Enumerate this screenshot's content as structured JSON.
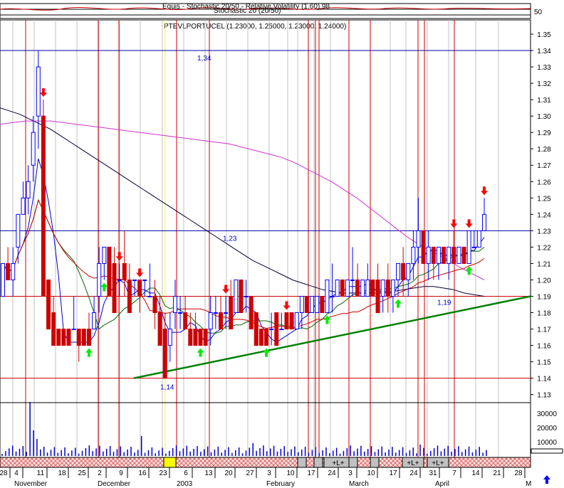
{
  "chart_data": {
    "type": "candlestick",
    "title": "PTEVLPORTUCEL (1.23000, 1.25000, 1.23000, 1.24000)",
    "top_panel": {
      "title_overlap": "Equis - Stochastic 20/50 - Relative Volatility (1.60) 98",
      "title_line2": "Stochastic 20 (20/50)",
      "tick_label": "50"
    },
    "y_ticks": [
      "1.35",
      "1.34",
      "1.33",
      "1.32",
      "1.31",
      "1.30",
      "1.29",
      "1.28",
      "1.27",
      "1.26",
      "1.25",
      "1.24",
      "1.23",
      "1.22",
      "1.21",
      "1.20",
      "1.19",
      "1.18",
      "1.17",
      "1.16",
      "1.15",
      "1.14",
      "1.13"
    ],
    "ylim": [
      1.125,
      1.355
    ],
    "volume_ticks": [
      "30000",
      "20000",
      "10000"
    ],
    "x_day_labels": [
      "28",
      "4",
      "11",
      "18",
      "25",
      "2",
      "9",
      "16",
      "23",
      "6",
      "13",
      "20",
      "27",
      "3",
      "10",
      "17",
      "24",
      "3",
      "10",
      "17",
      "24",
      "31",
      "7",
      "14",
      "21",
      "28"
    ],
    "x_month_labels": [
      "November",
      "December",
      "2003",
      "February",
      "March",
      "April",
      "M"
    ],
    "levels": [
      {
        "value": 1.34,
        "label": "1,34"
      },
      {
        "value": 1.23,
        "label": "1,23"
      },
      {
        "value": 1.19,
        "label": "1,19"
      },
      {
        "value": 1.14,
        "label": "1,14"
      }
    ],
    "level_lines": [
      1.34,
      1.23,
      1.19,
      1.14
    ],
    "trendline": {
      "from": 1.14,
      "to": 1.19,
      "color": "#008000"
    },
    "period_tags": [
      "+L+",
      "+L+",
      "+L+"
    ],
    "candles": [
      {
        "o": 1.19,
        "h": 1.21,
        "l": 1.19,
        "c": 1.21
      },
      {
        "o": 1.21,
        "h": 1.22,
        "l": 1.2,
        "c": 1.2
      },
      {
        "o": 1.2,
        "h": 1.22,
        "l": 1.19,
        "c": 1.21
      },
      {
        "o": 1.22,
        "h": 1.24,
        "l": 1.21,
        "c": 1.24
      },
      {
        "o": 1.24,
        "h": 1.26,
        "l": 1.24,
        "c": 1.25
      },
      {
        "o": 1.25,
        "h": 1.27,
        "l": 1.24,
        "c": 1.26
      },
      {
        "o": 1.27,
        "h": 1.3,
        "l": 1.26,
        "c": 1.29
      },
      {
        "o": 1.3,
        "h": 1.34,
        "l": 1.28,
        "c": 1.33
      },
      {
        "o": 1.3,
        "h": 1.31,
        "l": 1.19,
        "c": 1.19
      },
      {
        "o": 1.2,
        "h": 1.2,
        "l": 1.17,
        "c": 1.17
      },
      {
        "o": 1.18,
        "h": 1.19,
        "l": 1.16,
        "c": 1.16
      },
      {
        "o": 1.17,
        "h": 1.17,
        "l": 1.16,
        "c": 1.16
      },
      {
        "o": 1.17,
        "h": 1.17,
        "l": 1.16,
        "c": 1.16
      },
      {
        "o": 1.17,
        "h": 1.17,
        "l": 1.16,
        "c": 1.16
      },
      {
        "o": 1.17,
        "h": 1.19,
        "l": 1.17,
        "c": 1.17
      },
      {
        "o": 1.17,
        "h": 1.17,
        "l": 1.15,
        "c": 1.16
      },
      {
        "o": 1.17,
        "h": 1.17,
        "l": 1.16,
        "c": 1.16
      },
      {
        "o": 1.17,
        "h": 1.18,
        "l": 1.16,
        "c": 1.16
      },
      {
        "o": 1.17,
        "h": 1.19,
        "l": 1.17,
        "c": 1.18
      },
      {
        "o": 1.19,
        "h": 1.22,
        "l": 1.18,
        "c": 1.21
      },
      {
        "o": 1.21,
        "h": 1.22,
        "l": 1.2,
        "c": 1.22
      },
      {
        "o": 1.22,
        "h": 1.22,
        "l": 1.19,
        "c": 1.19
      },
      {
        "o": 1.21,
        "h": 1.22,
        "l": 1.18,
        "c": 1.18
      },
      {
        "o": 1.2,
        "h": 1.21,
        "l": 1.19,
        "c": 1.2
      },
      {
        "o": 1.21,
        "h": 1.23,
        "l": 1.19,
        "c": 1.2
      },
      {
        "o": 1.2,
        "h": 1.21,
        "l": 1.18,
        "c": 1.18
      },
      {
        "o": 1.2,
        "h": 1.2,
        "l": 1.19,
        "c": 1.2
      },
      {
        "o": 1.2,
        "h": 1.2,
        "l": 1.18,
        "c": 1.19
      },
      {
        "o": 1.2,
        "h": 1.2,
        "l": 1.19,
        "c": 1.2
      },
      {
        "o": 1.19,
        "h": 1.21,
        "l": 1.19,
        "c": 1.19
      },
      {
        "o": 1.19,
        "h": 1.2,
        "l": 1.17,
        "c": 1.18
      },
      {
        "o": 1.18,
        "h": 1.19,
        "l": 1.16,
        "c": 1.16
      },
      {
        "o": 1.17,
        "h": 1.18,
        "l": 1.14,
        "c": 1.14
      },
      {
        "o": 1.16,
        "h": 1.18,
        "l": 1.15,
        "c": 1.17
      },
      {
        "o": 1.18,
        "h": 1.2,
        "l": 1.17,
        "c": 1.19
      },
      {
        "o": 1.18,
        "h": 1.19,
        "l": 1.17,
        "c": 1.18
      },
      {
        "o": 1.18,
        "h": 1.19,
        "l": 1.17,
        "c": 1.17
      },
      {
        "o": 1.17,
        "h": 1.18,
        "l": 1.16,
        "c": 1.16
      },
      {
        "o": 1.17,
        "h": 1.18,
        "l": 1.16,
        "c": 1.16
      },
      {
        "o": 1.17,
        "h": 1.17,
        "l": 1.16,
        "c": 1.16
      },
      {
        "o": 1.17,
        "h": 1.17,
        "l": 1.16,
        "c": 1.16
      },
      {
        "o": 1.17,
        "h": 1.19,
        "l": 1.16,
        "c": 1.18
      },
      {
        "o": 1.18,
        "h": 1.19,
        "l": 1.17,
        "c": 1.18
      },
      {
        "o": 1.18,
        "h": 1.19,
        "l": 1.17,
        "c": 1.17
      },
      {
        "o": 1.18,
        "h": 1.19,
        "l": 1.17,
        "c": 1.18
      },
      {
        "o": 1.19,
        "h": 1.2,
        "l": 1.17,
        "c": 1.17
      },
      {
        "o": 1.18,
        "h": 1.2,
        "l": 1.18,
        "c": 1.2
      },
      {
        "o": 1.2,
        "h": 1.2,
        "l": 1.18,
        "c": 1.18
      },
      {
        "o": 1.19,
        "h": 1.2,
        "l": 1.18,
        "c": 1.19
      },
      {
        "o": 1.19,
        "h": 1.19,
        "l": 1.17,
        "c": 1.17
      },
      {
        "o": 1.18,
        "h": 1.18,
        "l": 1.16,
        "c": 1.16
      },
      {
        "o": 1.17,
        "h": 1.17,
        "l": 1.16,
        "c": 1.16
      },
      {
        "o": 1.17,
        "h": 1.17,
        "l": 1.16,
        "c": 1.16
      },
      {
        "o": 1.17,
        "h": 1.18,
        "l": 1.16,
        "c": 1.17
      },
      {
        "o": 1.18,
        "h": 1.18,
        "l": 1.16,
        "c": 1.16
      },
      {
        "o": 1.17,
        "h": 1.18,
        "l": 1.17,
        "c": 1.17
      },
      {
        "o": 1.18,
        "h": 1.18,
        "l": 1.17,
        "c": 1.17
      },
      {
        "o": 1.18,
        "h": 1.18,
        "l": 1.17,
        "c": 1.17
      },
      {
        "o": 1.17,
        "h": 1.18,
        "l": 1.17,
        "c": 1.18
      },
      {
        "o": 1.18,
        "h": 1.19,
        "l": 1.17,
        "c": 1.19
      },
      {
        "o": 1.19,
        "h": 1.19,
        "l": 1.18,
        "c": 1.18
      },
      {
        "o": 1.18,
        "h": 1.19,
        "l": 1.18,
        "c": 1.19
      },
      {
        "o": 1.18,
        "h": 1.19,
        "l": 1.18,
        "c": 1.19
      },
      {
        "o": 1.19,
        "h": 1.19,
        "l": 1.18,
        "c": 1.18
      },
      {
        "o": 1.18,
        "h": 1.2,
        "l": 1.18,
        "c": 1.2
      },
      {
        "o": 1.19,
        "h": 1.21,
        "l": 1.18,
        "c": 1.19
      },
      {
        "o": 1.19,
        "h": 1.2,
        "l": 1.19,
        "c": 1.2
      },
      {
        "o": 1.2,
        "h": 1.2,
        "l": 1.19,
        "c": 1.19
      },
      {
        "o": 1.19,
        "h": 1.2,
        "l": 1.19,
        "c": 1.2
      },
      {
        "o": 1.2,
        "h": 1.22,
        "l": 1.19,
        "c": 1.2
      },
      {
        "o": 1.2,
        "h": 1.21,
        "l": 1.19,
        "c": 1.19
      },
      {
        "o": 1.19,
        "h": 1.2,
        "l": 1.19,
        "c": 1.2
      },
      {
        "o": 1.19,
        "h": 1.21,
        "l": 1.19,
        "c": 1.2
      },
      {
        "o": 1.2,
        "h": 1.2,
        "l": 1.19,
        "c": 1.19
      },
      {
        "o": 1.2,
        "h": 1.21,
        "l": 1.18,
        "c": 1.18
      },
      {
        "o": 1.19,
        "h": 1.2,
        "l": 1.18,
        "c": 1.2
      },
      {
        "o": 1.2,
        "h": 1.21,
        "l": 1.18,
        "c": 1.19
      },
      {
        "o": 1.19,
        "h": 1.2,
        "l": 1.18,
        "c": 1.2
      },
      {
        "o": 1.2,
        "h": 1.21,
        "l": 1.19,
        "c": 1.21
      },
      {
        "o": 1.21,
        "h": 1.22,
        "l": 1.19,
        "c": 1.2
      },
      {
        "o": 1.2,
        "h": 1.21,
        "l": 1.19,
        "c": 1.21
      },
      {
        "o": 1.21,
        "h": 1.23,
        "l": 1.2,
        "c": 1.22
      },
      {
        "o": 1.22,
        "h": 1.25,
        "l": 1.21,
        "c": 1.23
      },
      {
        "o": 1.23,
        "h": 1.23,
        "l": 1.21,
        "c": 1.21
      },
      {
        "o": 1.21,
        "h": 1.23,
        "l": 1.2,
        "c": 1.22
      },
      {
        "o": 1.22,
        "h": 1.22,
        "l": 1.2,
        "c": 1.21
      },
      {
        "o": 1.21,
        "h": 1.22,
        "l": 1.2,
        "c": 1.22
      },
      {
        "o": 1.22,
        "h": 1.22,
        "l": 1.21,
        "c": 1.21
      },
      {
        "o": 1.21,
        "h": 1.22,
        "l": 1.2,
        "c": 1.22
      },
      {
        "o": 1.22,
        "h": 1.23,
        "l": 1.21,
        "c": 1.21
      },
      {
        "o": 1.21,
        "h": 1.22,
        "l": 1.21,
        "c": 1.22
      },
      {
        "o": 1.22,
        "h": 1.22,
        "l": 1.21,
        "c": 1.21
      },
      {
        "o": 1.21,
        "h": 1.23,
        "l": 1.21,
        "c": 1.23
      },
      {
        "o": 1.22,
        "h": 1.23,
        "l": 1.22,
        "c": 1.22
      },
      {
        "o": 1.22,
        "h": 1.23,
        "l": 1.22,
        "c": 1.23
      },
      {
        "o": 1.23,
        "h": 1.25,
        "l": 1.23,
        "c": 1.24
      }
    ],
    "sell_signals": [
      8,
      23,
      27,
      44,
      56,
      89,
      92,
      95,
      99,
      112
    ],
    "buy_signals": [
      17,
      20,
      39,
      52,
      64,
      78,
      92,
      103,
      109,
      117
    ],
    "ma_slow": [
      1.305,
      1.303,
      1.301,
      1.298,
      1.295,
      1.292,
      1.288,
      1.284,
      1.28,
      1.276,
      1.272,
      1.268,
      1.264,
      1.26,
      1.256,
      1.252,
      1.248,
      1.244,
      1.24,
      1.236,
      1.232,
      1.228,
      1.224,
      1.22,
      1.216,
      1.212,
      1.209,
      1.206,
      1.203,
      1.2,
      1.198,
      1.196,
      1.194,
      1.193,
      1.192,
      1.192,
      1.192,
      1.192,
      1.192,
      1.193,
      1.194,
      1.195,
      1.196,
      1.196,
      1.195,
      1.194,
      1.192,
      1.191,
      1.19
    ],
    "ma_magenta": [
      1.295,
      1.296,
      1.297,
      1.297,
      1.297,
      1.296,
      1.295,
      1.294,
      1.293,
      1.292,
      1.291,
      1.29,
      1.289,
      1.288,
      1.287,
      1.286,
      1.285,
      1.284,
      1.283,
      1.281,
      1.279,
      1.277,
      1.275,
      1.272,
      1.268,
      1.264,
      1.26,
      1.255,
      1.25,
      1.244,
      1.238,
      1.232,
      1.226,
      1.221,
      1.217,
      1.213,
      1.208,
      1.204,
      1.2
    ]
  }
}
